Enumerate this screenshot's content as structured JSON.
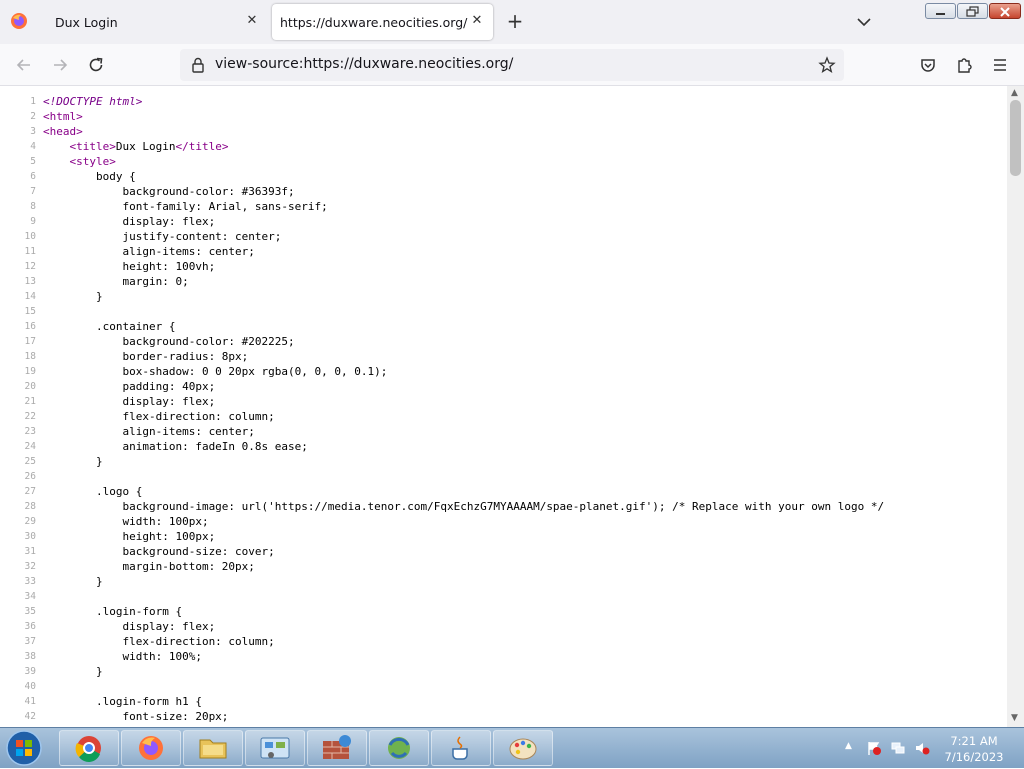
{
  "browser": {
    "tabs": [
      {
        "title": "Dux Login",
        "active": false
      },
      {
        "title": "https://duxware.neocities.org/",
        "active": true
      }
    ],
    "url": "view-source:https://duxware.neocities.org/",
    "icons": {
      "logo": "firefox-logo-icon",
      "back": "back-arrow-icon",
      "forward": "forward-arrow-icon",
      "reload": "reload-icon",
      "lock": "lock-icon",
      "bookmark": "star-icon",
      "pocket": "pocket-icon",
      "extensions": "puzzle-icon",
      "menu": "hamburger-icon"
    }
  },
  "source_lines": [
    {
      "n": "1",
      "t": "<!DOCTYPE html>"
    },
    {
      "n": "2",
      "t": "<html>"
    },
    {
      "n": "3",
      "t": "<head>"
    },
    {
      "n": "4",
      "t": "    <title>Dux Login</title>"
    },
    {
      "n": "5",
      "t": "    <style>"
    },
    {
      "n": "6",
      "t": "        body {"
    },
    {
      "n": "7",
      "t": "            background-color: #36393f;"
    },
    {
      "n": "8",
      "t": "            font-family: Arial, sans-serif;"
    },
    {
      "n": "9",
      "t": "            display: flex;"
    },
    {
      "n": "10",
      "t": "            justify-content: center;"
    },
    {
      "n": "11",
      "t": "            align-items: center;"
    },
    {
      "n": "12",
      "t": "            height: 100vh;"
    },
    {
      "n": "13",
      "t": "            margin: 0;"
    },
    {
      "n": "14",
      "t": "        }"
    },
    {
      "n": "15",
      "t": ""
    },
    {
      "n": "16",
      "t": "        .container {"
    },
    {
      "n": "17",
      "t": "            background-color: #202225;"
    },
    {
      "n": "18",
      "t": "            border-radius: 8px;"
    },
    {
      "n": "19",
      "t": "            box-shadow: 0 0 20px rgba(0, 0, 0, 0.1);"
    },
    {
      "n": "20",
      "t": "            padding: 40px;"
    },
    {
      "n": "21",
      "t": "            display: flex;"
    },
    {
      "n": "22",
      "t": "            flex-direction: column;"
    },
    {
      "n": "23",
      "t": "            align-items: center;"
    },
    {
      "n": "24",
      "t": "            animation: fadeIn 0.8s ease;"
    },
    {
      "n": "25",
      "t": "        }"
    },
    {
      "n": "26",
      "t": ""
    },
    {
      "n": "27",
      "t": "        .logo {"
    },
    {
      "n": "28",
      "t": "            background-image: url('https://media.tenor.com/FqxEchzG7MYAAAAM/spae-planet.gif'); /* Replace with your own logo */"
    },
    {
      "n": "29",
      "t": "            width: 100px;"
    },
    {
      "n": "30",
      "t": "            height: 100px;"
    },
    {
      "n": "31",
      "t": "            background-size: cover;"
    },
    {
      "n": "32",
      "t": "            margin-bottom: 20px;"
    },
    {
      "n": "33",
      "t": "        }"
    },
    {
      "n": "34",
      "t": ""
    },
    {
      "n": "35",
      "t": "        .login-form {"
    },
    {
      "n": "36",
      "t": "            display: flex;"
    },
    {
      "n": "37",
      "t": "            flex-direction: column;"
    },
    {
      "n": "38",
      "t": "            width: 100%;"
    },
    {
      "n": "39",
      "t": "        }"
    },
    {
      "n": "40",
      "t": ""
    },
    {
      "n": "41",
      "t": "        .login-form h1 {"
    },
    {
      "n": "42",
      "t": "            font-size: 20px;"
    }
  ],
  "taskbar": {
    "items": [
      "chrome-icon",
      "firefox-icon",
      "file-explorer-icon",
      "control-panel-icon",
      "firewall-icon",
      "network-icon",
      "java-icon",
      "paint-icon"
    ],
    "clock_time": "7:21 AM",
    "clock_date": "7/16/2023"
  }
}
